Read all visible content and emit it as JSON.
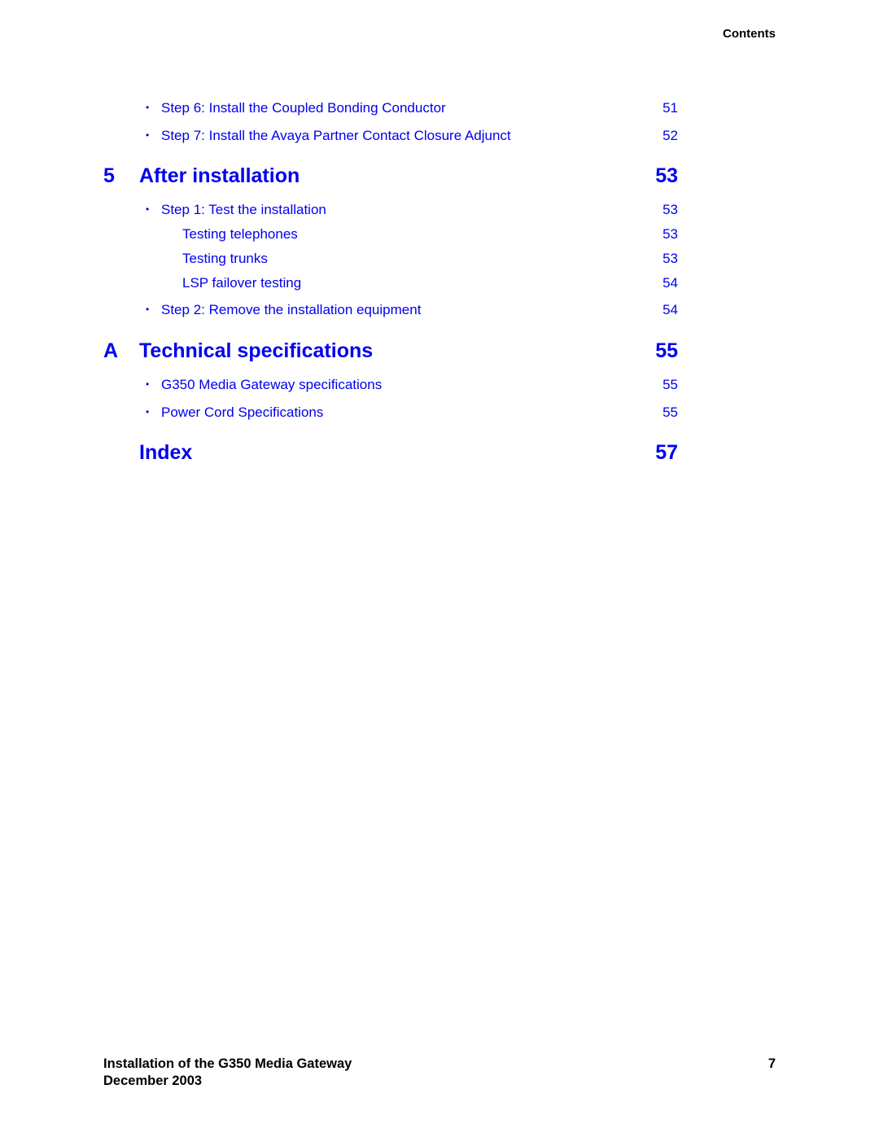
{
  "header": {
    "section_label": "Contents"
  },
  "toc": {
    "pre_entries": [
      {
        "label": "Step 6: Install the Coupled Bonding Conductor",
        "page": "51"
      },
      {
        "label": "Step 7: Install the Avaya Partner Contact Closure Adjunct",
        "page": "52"
      }
    ],
    "chapters": [
      {
        "number": "5",
        "title": "After installation",
        "page": "53",
        "entries": [
          {
            "label": "Step 1: Test the installation",
            "page": "53",
            "subentries": [
              {
                "label": "Testing telephones",
                "page": "53"
              },
              {
                "label": "Testing trunks",
                "page": "53"
              },
              {
                "label": "LSP failover testing",
                "page": "54"
              }
            ]
          },
          {
            "label": "Step 2: Remove the installation equipment",
            "page": "54"
          }
        ]
      },
      {
        "number": "A",
        "title": "Technical specifications",
        "page": "55",
        "entries": [
          {
            "label": "G350 Media Gateway specifications",
            "page": "55"
          },
          {
            "label": "Power Cord Specifications",
            "page": "55"
          }
        ]
      },
      {
        "number": "",
        "title": "Index",
        "page": "57",
        "entries": []
      }
    ],
    "bullet_glyph": "•"
  },
  "footer": {
    "doc_title": "Installation of the G350 Media Gateway",
    "date": "December 2003",
    "page_number": "7"
  },
  "colors": {
    "link": "#0000ee",
    "text": "#000000"
  }
}
